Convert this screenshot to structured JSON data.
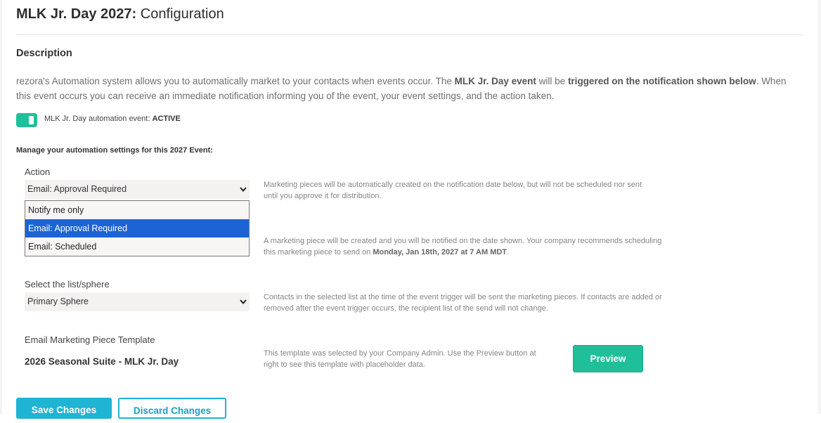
{
  "header": {
    "title_bold": "MLK Jr. Day 2027:",
    "title_rest": "Configuration"
  },
  "description": {
    "heading": "Description",
    "text_1": "rezora's Automation system allows you to automatically market to your contacts when events occur. The ",
    "event_name": "MLK Jr. Day event",
    "text_2": " will be ",
    "trigger_text": "triggered on the notification shown below",
    "text_3": ". When this event occurs you can receive an immediate notification informing you of the event, your event settings, and the action taken."
  },
  "toggle": {
    "label": "MLK Jr. Day automation event: ",
    "status": "ACTIVE",
    "on": true
  },
  "manage_heading": "Manage your automation settings for this 2027 Event:",
  "action": {
    "label": "Action",
    "selected": "Email: Approval Required",
    "options": [
      "Notify me only",
      "Email: Approval Required",
      "Email: Scheduled"
    ],
    "help_1": "Marketing pieces will be automatically created on the notification date below, but will not be scheduled nor sent until you approve it for distribution.",
    "help_2_pre": "A marketing piece will be created and you will be notified on the date shown. Your company recommends scheduling this marketing piece to send on ",
    "help_2_date": "Monday, Jan 18th, 2027 at 7 AM MDT",
    "help_2_post": "."
  },
  "list": {
    "label": "Select the list/sphere",
    "selected": "Primary Sphere",
    "help": "Contacts in the selected list at the time of the event trigger will be sent the marketing pieces. If contacts are added or removed after the event trigger occurs, the recipient list of the send will not change."
  },
  "template": {
    "label": "Email Marketing Piece Template",
    "name": "2026 Seasonal Suite - MLK Jr. Day",
    "help": "This template was selected by your Company Admin. Use the Preview button at right to see this template with placeholder data.",
    "preview_label": "Preview"
  },
  "footer": {
    "save_label": "Save Changes",
    "discard_label": "Discard Changes"
  },
  "colors": {
    "accent_green": "#1fbf9a",
    "accent_blue": "#1fb3d4",
    "selected_option": "#1c64d6"
  },
  "icons": {
    "select_chevron": "chevron-down-icon"
  }
}
